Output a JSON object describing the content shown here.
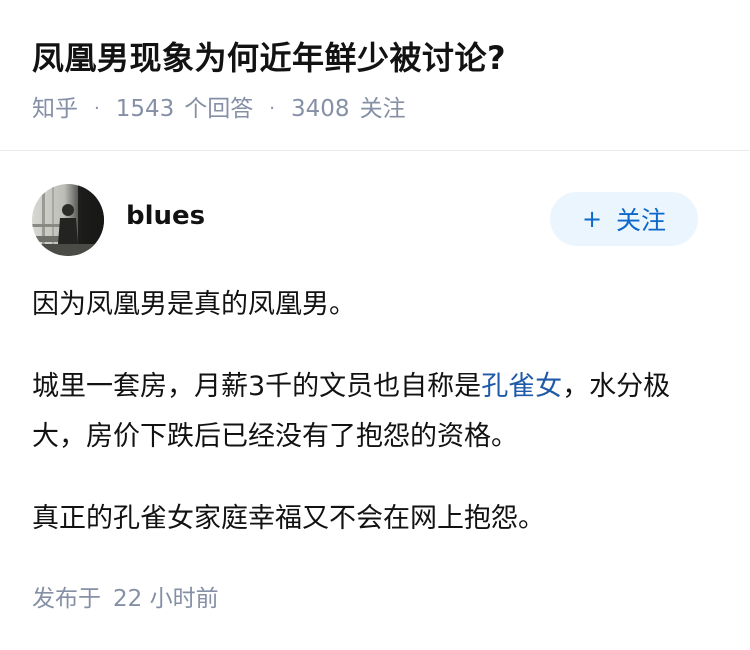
{
  "question": {
    "title": "凤凰男现象为何近年鲜少被讨论?",
    "source": "知乎",
    "answer_count": "1543",
    "answer_label": "个回答",
    "follower_count": "3408",
    "follower_label": "关注",
    "separator": "·"
  },
  "author": {
    "name": "blues",
    "avatar_icon": "avatar-photo-icon",
    "follow_plus": "+",
    "follow_label": "关注"
  },
  "answer": {
    "p1": "因为凤凰男是真的凤凰男。",
    "p2_before": "城里一套房，月薪3千的文员也自称是",
    "p2_link": "孔雀女",
    "p2_after": "，水分极大，房价下跌后已经没有了抱怨的资格。",
    "p3": "真正的孔雀女家庭幸福又不会在网上抱怨。"
  },
  "footer": {
    "label": "发布于",
    "time": "22 小时前"
  },
  "colors": {
    "meta_gray": "#8590a6",
    "link_blue": "#1e5aa8",
    "button_bg": "#ebf5fd"
  }
}
